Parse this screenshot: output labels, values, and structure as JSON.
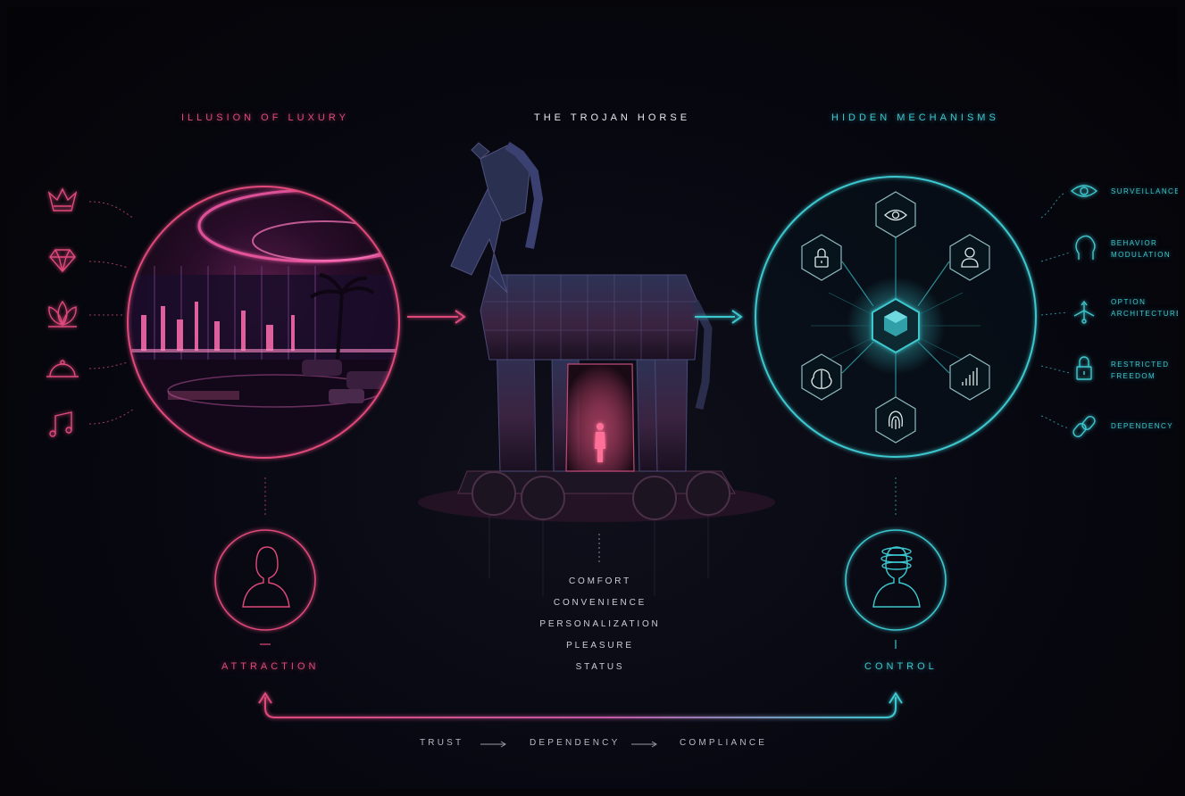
{
  "sections": {
    "left_title": "ILLUSION OF LUXURY",
    "center_title": "THE TROJAN HORSE",
    "right_title": "HIDDEN MECHANISMS"
  },
  "left_icons": [
    "crown-icon",
    "diamond-icon",
    "lotus-icon",
    "cloche-icon",
    "music-note-icon"
  ],
  "horse_traits": [
    "COMFORT",
    "CONVENIENCE",
    "PERSONALIZATION",
    "PLEASURE",
    "STATUS"
  ],
  "mechanisms": {
    "hub_icons": [
      "eye-icon",
      "lock-icon",
      "user-icon",
      "brain-icon",
      "signal-bars-icon",
      "fingerprint-icon"
    ],
    "legend": [
      {
        "icon": "eye-icon",
        "line1": "SURVEILLANCE",
        "line2": ""
      },
      {
        "icon": "head-icon",
        "line1": "BEHAVIOR",
        "line2": "MODULATION"
      },
      {
        "icon": "branching-arrows-icon",
        "line1": "OPTION",
        "line2": "ARCHITECTURE"
      },
      {
        "icon": "lock-icon",
        "line1": "RESTRICTED",
        "line2": "FREEDOM"
      },
      {
        "icon": "chain-link-icon",
        "line1": "DEPENDENCY",
        "line2": ""
      }
    ]
  },
  "bottom": {
    "left_label": "ATTRACTION",
    "right_label": "CONTROL",
    "flow": [
      "TRUST",
      "DEPENDENCY",
      "COMPLIANCE"
    ]
  },
  "colors": {
    "pink": "#e0497a",
    "cyan": "#3cc7cf",
    "background": "#05050a"
  }
}
